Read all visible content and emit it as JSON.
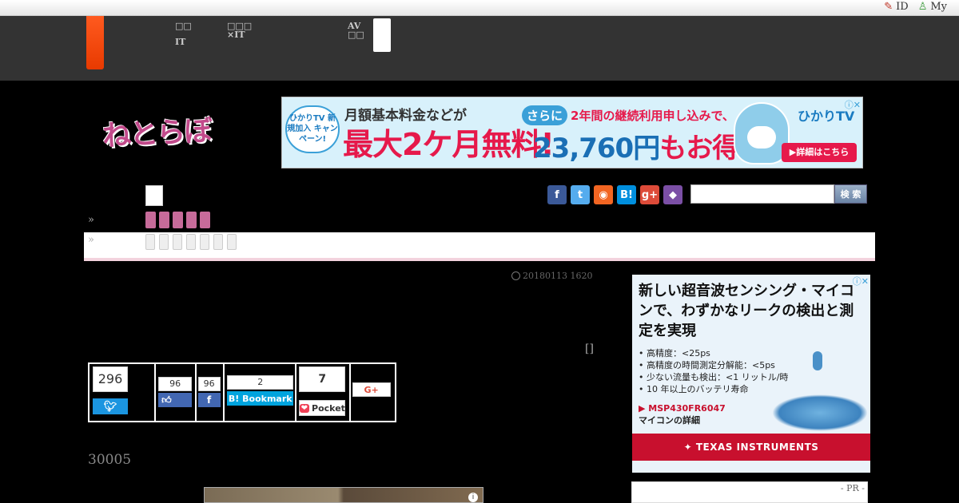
{
  "utility_bar": {
    "id_link": "ID",
    "my_link": "My"
  },
  "global_nav": {
    "items": [
      {
        "line1": "□□",
        "line2": "IT"
      },
      {
        "line1": "□□□",
        "line2": "×IT"
      },
      {
        "line1": "AV",
        "line2": "□□"
      }
    ]
  },
  "logo": {
    "text": "ねとらぼ"
  },
  "top_banner": {
    "tag": "ひかりTV 新規加入 キャンペーン!",
    "line1": "月額基本料金などが",
    "line2": "最大2ケ月無料!",
    "line3_prefix": "さらに",
    "line3": "2年間の継続利用申し込みで、",
    "price": "23,760円",
    "price_suffix": "もお得!!",
    "brand": "ひかりTV",
    "detail_button": "▶詳細はこちら",
    "adchoice": "ⓘ✕"
  },
  "toolbar": {
    "search_button": "検 索",
    "search_placeholder": ""
  },
  "social_icons": [
    {
      "icon": "facebook-icon",
      "glyph": "f",
      "color": "#3b5998"
    },
    {
      "icon": "twitter-icon",
      "glyph": "t",
      "color": "#55acee"
    },
    {
      "icon": "rss-icon",
      "glyph": "◉",
      "color": "#f26522"
    },
    {
      "icon": "hatena-icon",
      "glyph": "B!",
      "color": "#008fde"
    },
    {
      "icon": "googleplus-icon",
      "glyph": "g+",
      "color": "#dd4b39"
    },
    {
      "icon": "cat-icon",
      "glyph": "◆",
      "color": "#7b4fa5"
    }
  ],
  "breadcrumb": {
    "sep1": "»",
    "sep2": "»"
  },
  "article": {
    "date": "20180113 1620",
    "bracket": "[]",
    "count_heading": "30005"
  },
  "share": {
    "twitter_count": "296",
    "facebook_like_count": "96",
    "facebook_share_count": "96",
    "hatena_count": "2",
    "hatena_label": "B! Bookmark",
    "pocket_count": "7",
    "pocket_label": "Pocket",
    "gplus_label": "G+"
  },
  "side_ad": {
    "headline": "新しい超音波センシング・マイコンで、わずかなリークの検出と測定を実現",
    "bullets": [
      "• 高精度：<25ps",
      "• 高精度の時間測定分解能：<5ps",
      "• 少ない流量も検出：<1 リットル/時",
      "• 10 年以上のバッテリ寿命"
    ],
    "link_line1": "▶ MSP430FR6047",
    "link_line2": "マイコンの詳細",
    "brand": "TEXAS INSTRUMENTS",
    "adchoice": "ⓘ✕"
  },
  "pr_box": {
    "label": "- PR -"
  }
}
